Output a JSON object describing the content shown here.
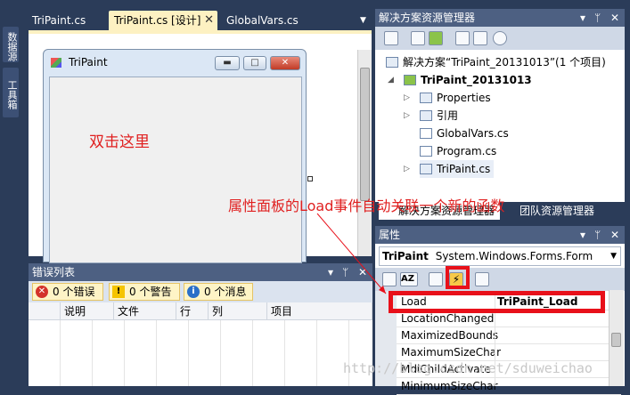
{
  "left_strip": {
    "tab1": "数据源",
    "tab2": "工具箱"
  },
  "doc_tabs": [
    {
      "label": "TriPaint.cs"
    },
    {
      "label": "TriPaint.cs [设计]",
      "active": true
    },
    {
      "label": "GlobalVars.cs"
    }
  ],
  "designer": {
    "form_title": "TriPaint",
    "instruction": "双击这里"
  },
  "error_list": {
    "title": "错误列表",
    "errors": "0 个错误",
    "warnings": "0 个警告",
    "messages": "0 个消息",
    "columns": [
      "说明",
      "文件",
      "行",
      "列",
      "项目"
    ]
  },
  "solution": {
    "title": "解决方案资源管理器",
    "items": [
      {
        "label": "解决方案“TriPaint_20131013”(1 个项目)"
      },
      {
        "label": "TriPaint_20131013"
      },
      {
        "label": "Properties"
      },
      {
        "label": "引用"
      },
      {
        "label": "GlobalVars.cs"
      },
      {
        "label": "Program.cs"
      },
      {
        "label": "TriPaint.cs"
      }
    ],
    "bottom_tabs": [
      "解决方案资源管理器",
      "团队资源管理器"
    ]
  },
  "properties": {
    "title": "属性",
    "object_name": "TriPaint",
    "object_type": "System.Windows.Forms.Form",
    "rows": [
      {
        "name": "Load",
        "value": "TriPaint_Load"
      },
      {
        "name": "LocationChanged",
        "value": ""
      },
      {
        "name": "MaximizedBounds",
        "value": ""
      },
      {
        "name": "MaximumSizeChar",
        "value": ""
      },
      {
        "name": "MdiChildActivate",
        "value": ""
      },
      {
        "name": "MinimumSizeChar",
        "value": ""
      }
    ]
  },
  "annotation": "属性面板的Load事件自动关联一个新的函数",
  "watermark": "http://blog.csdn.net/sduweichao",
  "colors": {
    "accent_red": "#e8101a",
    "tab_active": "#fdf1c2",
    "ide_background": "#2b3c59",
    "panel_header": "#4d6082"
  }
}
